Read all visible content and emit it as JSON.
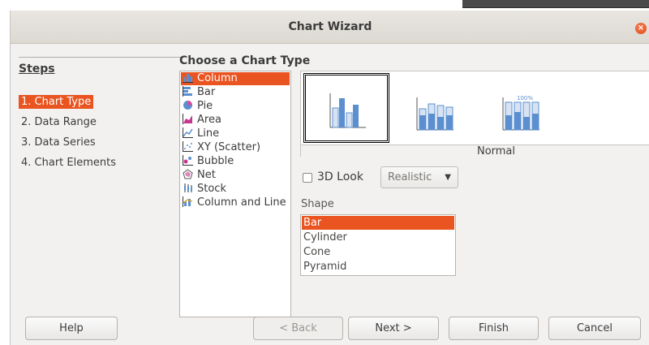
{
  "window": {
    "title": "Chart Wizard"
  },
  "steps": {
    "heading": "Steps",
    "items": [
      "1. Chart Type",
      "2. Data Range",
      "3. Data Series",
      "4. Chart Elements"
    ],
    "active_index": 0
  },
  "chart_type": {
    "heading": "Choose a Chart Type",
    "types": [
      {
        "label": "Column",
        "icon": "column-chart-icon",
        "selected": true
      },
      {
        "label": "Bar",
        "icon": "bar-chart-icon",
        "selected": false
      },
      {
        "label": "Pie",
        "icon": "pie-chart-icon",
        "selected": false
      },
      {
        "label": "Area",
        "icon": "area-chart-icon",
        "selected": false
      },
      {
        "label": "Line",
        "icon": "line-chart-icon",
        "selected": false
      },
      {
        "label": "XY (Scatter)",
        "icon": "scatter-chart-icon",
        "selected": false
      },
      {
        "label": "Bubble",
        "icon": "bubble-chart-icon",
        "selected": false
      },
      {
        "label": "Net",
        "icon": "net-chart-icon",
        "selected": false
      },
      {
        "label": "Stock",
        "icon": "stock-chart-icon",
        "selected": false
      },
      {
        "label": "Column and Line",
        "icon": "column-and-line-chart-icon",
        "selected": false
      }
    ]
  },
  "preview": {
    "variant_label": "Normal",
    "variants": [
      {
        "name": "normal-column-variant",
        "selected": true
      },
      {
        "name": "stacked-column-variant",
        "selected": false
      },
      {
        "name": "percent-stacked-column-variant",
        "selected": false,
        "badge": "100%"
      }
    ]
  },
  "options": {
    "look_label": "3D Look",
    "look_checked": false,
    "look_select_value": "Realistic",
    "shape_label": "Shape",
    "shapes": [
      "Bar",
      "Cylinder",
      "Cone",
      "Pyramid"
    ],
    "shape_selected_index": 0
  },
  "buttons": {
    "help": "Help",
    "back": "< Back",
    "next": "Next >",
    "finish": "Finish",
    "cancel": "Cancel"
  },
  "colors": {
    "accent": "#e95420",
    "chart_blue": "#5b8fd0"
  }
}
